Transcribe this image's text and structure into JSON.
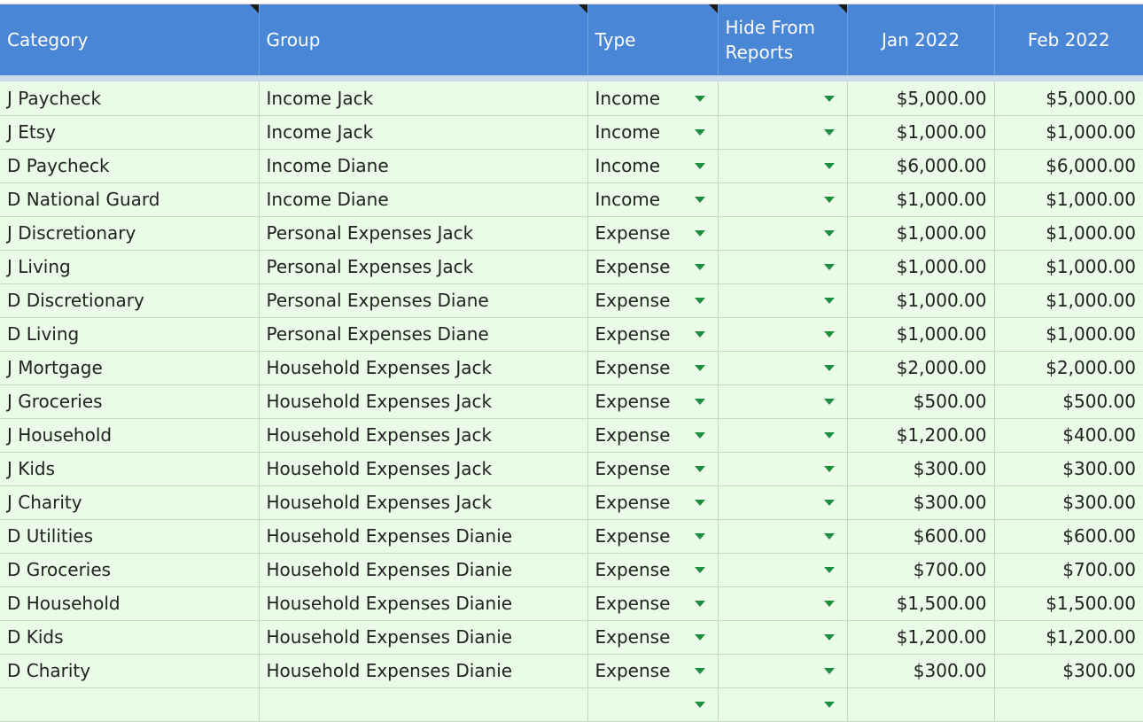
{
  "columns": {
    "category": "Category",
    "group": "Group",
    "type": "Type",
    "hide": "Hide From Reports",
    "jan": "Jan 2022",
    "feb": "Feb 2022"
  },
  "rows": [
    {
      "category": "J Paycheck",
      "group": "Income Jack",
      "type": "Income",
      "hide": "",
      "jan": "$5,000.00",
      "feb": "$5,000.00"
    },
    {
      "category": "J Etsy",
      "group": "Income Jack",
      "type": "Income",
      "hide": "",
      "jan": "$1,000.00",
      "feb": "$1,000.00"
    },
    {
      "category": "D Paycheck",
      "group": "Income Diane",
      "type": "Income",
      "hide": "",
      "jan": "$6,000.00",
      "feb": "$6,000.00"
    },
    {
      "category": "D National Guard",
      "group": "Income Diane",
      "type": "Income",
      "hide": "",
      "jan": "$1,000.00",
      "feb": "$1,000.00"
    },
    {
      "category": "J Discretionary",
      "group": "Personal Expenses Jack",
      "type": "Expense",
      "hide": "",
      "jan": "$1,000.00",
      "feb": "$1,000.00"
    },
    {
      "category": "J Living",
      "group": "Personal Expenses Jack",
      "type": "Expense",
      "hide": "",
      "jan": "$1,000.00",
      "feb": "$1,000.00"
    },
    {
      "category": "D Discretionary",
      "group": "Personal Expenses Diane",
      "type": "Expense",
      "hide": "",
      "jan": "$1,000.00",
      "feb": "$1,000.00"
    },
    {
      "category": "D Living",
      "group": "Personal Expenses Diane",
      "type": "Expense",
      "hide": "",
      "jan": "$1,000.00",
      "feb": "$1,000.00"
    },
    {
      "category": "J Mortgage",
      "group": "Household Expenses Jack",
      "type": "Expense",
      "hide": "",
      "jan": "$2,000.00",
      "feb": "$2,000.00"
    },
    {
      "category": "J Groceries",
      "group": "Household Expenses Jack",
      "type": "Expense",
      "hide": "",
      "jan": "$500.00",
      "feb": "$500.00"
    },
    {
      "category": "J Household",
      "group": "Household Expenses Jack",
      "type": "Expense",
      "hide": "",
      "jan": "$1,200.00",
      "feb": "$400.00"
    },
    {
      "category": "J Kids",
      "group": "Household Expenses Jack",
      "type": "Expense",
      "hide": "",
      "jan": "$300.00",
      "feb": "$300.00"
    },
    {
      "category": "J Charity",
      "group": "Household Expenses Jack",
      "type": "Expense",
      "hide": "",
      "jan": "$300.00",
      "feb": "$300.00"
    },
    {
      "category": "D Utilities",
      "group": "Household Expenses Dianie",
      "type": "Expense",
      "hide": "",
      "jan": "$600.00",
      "feb": "$600.00"
    },
    {
      "category": "D Groceries",
      "group": "Household Expenses Dianie",
      "type": "Expense",
      "hide": "",
      "jan": "$700.00",
      "feb": "$700.00"
    },
    {
      "category": "D Household",
      "group": "Household Expenses Dianie",
      "type": "Expense",
      "hide": "",
      "jan": "$1,500.00",
      "feb": "$1,500.00"
    },
    {
      "category": "D Kids",
      "group": "Household Expenses Dianie",
      "type": "Expense",
      "hide": "",
      "jan": "$1,200.00",
      "feb": "$1,200.00"
    },
    {
      "category": "D Charity",
      "group": "Household Expenses Dianie",
      "type": "Expense",
      "hide": "",
      "jan": "$300.00",
      "feb": "$300.00"
    },
    {
      "category": "",
      "group": "",
      "type": "",
      "hide": "",
      "jan": "",
      "feb": ""
    }
  ],
  "colors": {
    "header_bg": "#4a86d6",
    "row_bg": "#eafbe7",
    "dropdown_arrow": "#1e8e3e"
  },
  "icons": {
    "dropdown": "triangle-down-icon",
    "note": "note-corner-icon"
  }
}
